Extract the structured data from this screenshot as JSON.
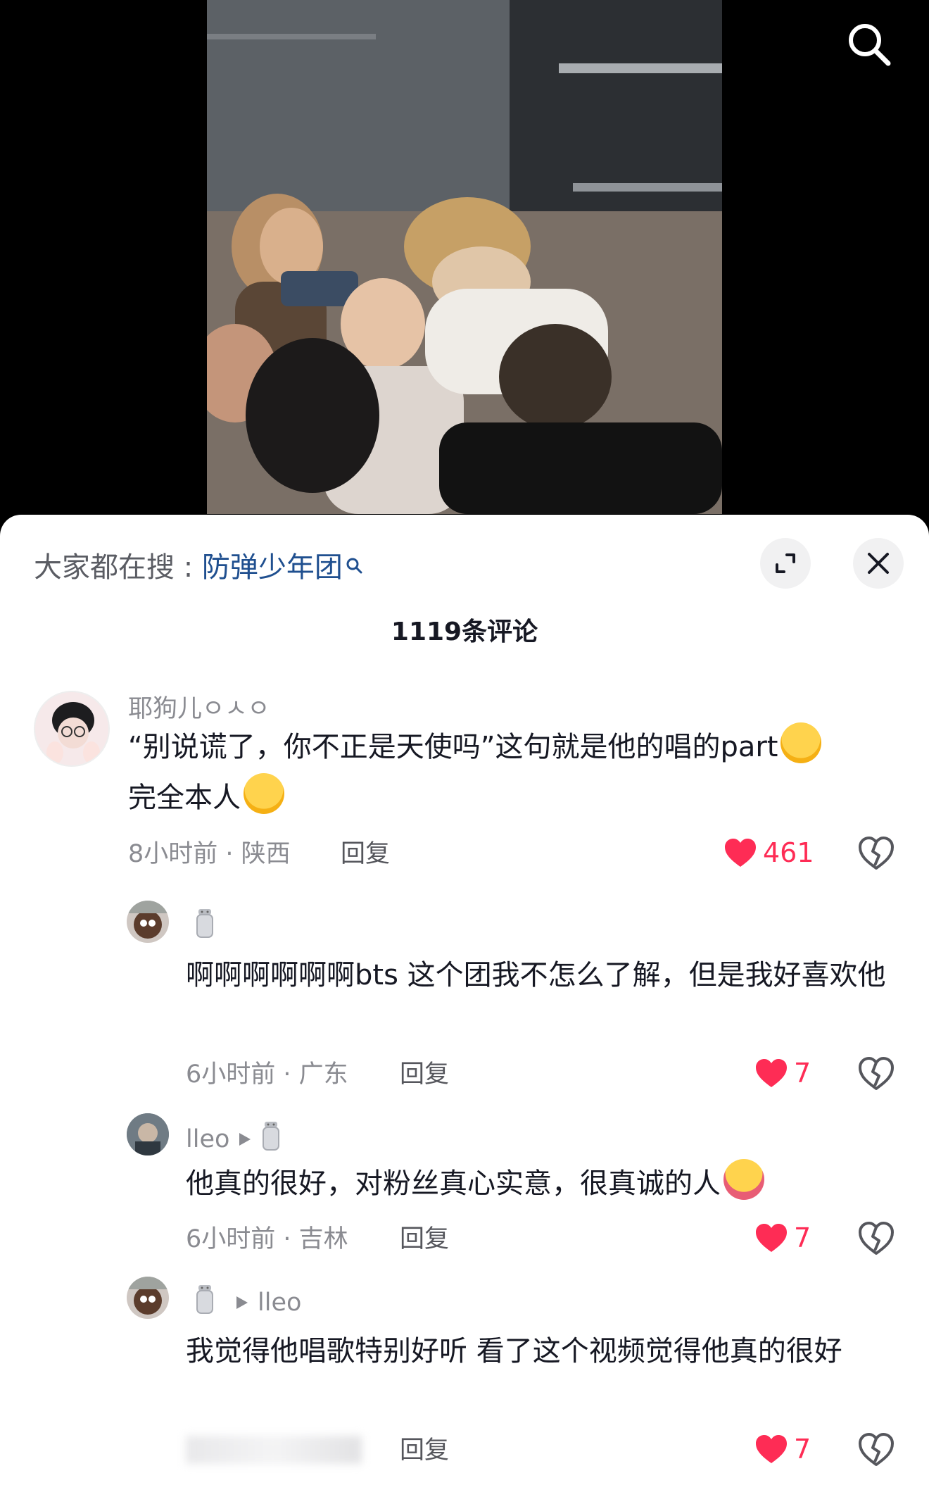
{
  "search_bar": {
    "prefix": "大家都在搜 : ",
    "term": "防弹少年团"
  },
  "comment_count_title": "1119条评论",
  "comments": [
    {
      "username": "耶狗儿ㅇㅅㅇ",
      "text": "“别说谎了，你不正是天使吗”这句就是他的唱的part",
      "text_line2": "完全本人",
      "meta": "8小时前 · 陕西",
      "reply": "回复",
      "likes": "461"
    },
    {
      "text": "啊啊啊啊啊啊bts 这个团我不怎么了解，但是我好喜欢他",
      "meta": "6小时前 · 广东",
      "reply": "回复",
      "likes": "7"
    },
    {
      "username": "lleo",
      "text": "他真的很好，对粉丝真心实意，很真诚的人",
      "meta": "6小时前 · 吉林",
      "reply": "回复",
      "likes": "7"
    },
    {
      "reply_to": "lleo",
      "text": "我觉得他唱歌特别好听 看了这个视频觉得他真的很好",
      "reply": "回复",
      "likes": "7"
    }
  ],
  "icons": {
    "search": "search-icon",
    "expand": "expand-icon",
    "close": "close-icon",
    "like": "heart-icon",
    "dislike": "broken-heart-icon",
    "salt": "salt-shaker-icon",
    "play": "play-triangle-icon"
  },
  "colors": {
    "like": "#fe2c55",
    "search_term": "#1f4f8f",
    "meta": "#8a8b91"
  }
}
